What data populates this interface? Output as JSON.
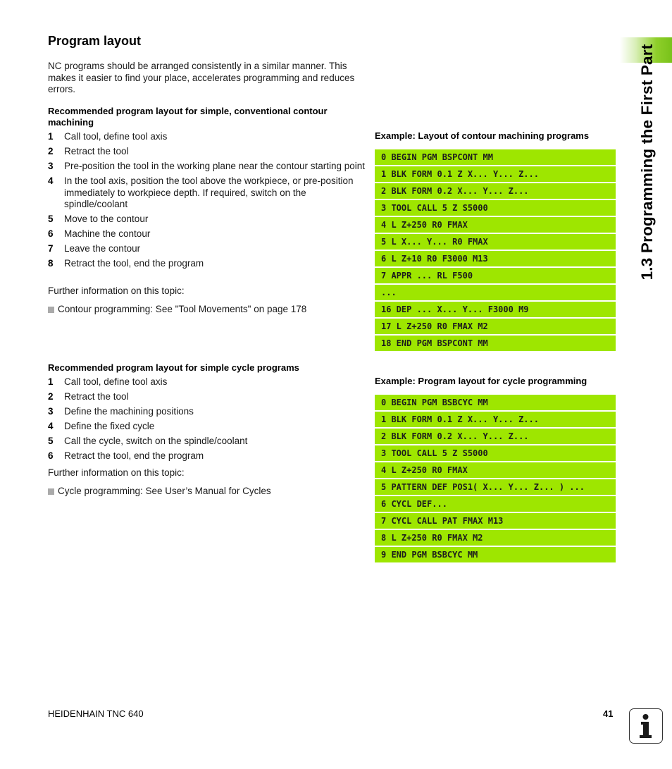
{
  "page": {
    "title": "Program layout",
    "intro": "NC programs should be arranged consistently in a similar manner. This makes it easier to find your place, accelerates programming and reduces errors.",
    "side_title": "1.3 Programming the First Part",
    "footer_left": "HEIDENHAIN TNC 640",
    "page_number": "41",
    "accent_color": "#9ee600"
  },
  "contour": {
    "heading": "Recommended program layout for simple, conventional contour machining",
    "steps": [
      {
        "num": "1",
        "text": "Call tool, define tool axis"
      },
      {
        "num": "2",
        "text": "Retract the tool"
      },
      {
        "num": "3",
        "text": "Pre-position the tool in the working plane near the contour starting point"
      },
      {
        "num": "4",
        "text": "In the tool axis, position the tool above the workpiece, or pre-position immediately to workpiece depth. If required, switch on the spindle/coolant"
      },
      {
        "num": "5",
        "text": "Move to the contour"
      },
      {
        "num": "6",
        "text": "Machine the contour"
      },
      {
        "num": "7",
        "text": "Leave the contour"
      },
      {
        "num": "8",
        "text": "Retract the tool, end the program"
      }
    ],
    "further_info": "Further information on this topic:",
    "link": "Contour programming: See \"Tool Movements\" on page 178",
    "example_title": "Example: Layout of contour machining programs",
    "example_lines": [
      "0 BEGIN PGM BSPCONT MM",
      "1 BLK FORM 0.1 Z X... Y... Z...",
      "2 BLK FORM 0.2 X... Y... Z...",
      "3 TOOL CALL 5 Z S5000",
      "4 L Z+250 R0 FMAX",
      "5 L X... Y... R0 FMAX",
      "6 L Z+10 R0 F3000 M13",
      "7 APPR ... RL F500",
      "...",
      "16 DEP ... X... Y... F3000 M9",
      "17 L Z+250 R0 FMAX M2",
      "18 END PGM BSPCONT MM"
    ]
  },
  "cycle": {
    "heading": "Recommended program layout for simple cycle programs",
    "steps": [
      {
        "num": "1",
        "text": "Call tool, define tool axis"
      },
      {
        "num": "2",
        "text": "Retract the tool"
      },
      {
        "num": "3",
        "text": "Define the machining positions"
      },
      {
        "num": "4",
        "text": "Define the fixed cycle"
      },
      {
        "num": "5",
        "text": "Call the cycle, switch on the spindle/coolant"
      },
      {
        "num": "6",
        "text": "Retract the tool, end the program"
      }
    ],
    "further_info": "Further information on this topic:",
    "link": "Cycle programming: See User’s Manual for Cycles",
    "example_title": "Example: Program layout for cycle programming",
    "example_lines": [
      "0 BEGIN PGM BSBCYC MM",
      "1 BLK FORM 0.1 Z X... Y... Z...",
      "2 BLK FORM 0.2 X... Y... Z...",
      "3 TOOL CALL 5 Z S5000",
      "4 L Z+250 R0 FMAX",
      "5 PATTERN DEF POS1( X... Y... Z... ) ...",
      "6 CYCL DEF...",
      "7 CYCL CALL PAT FMAX M13",
      "8 L Z+250 R0 FMAX M2",
      "9 END PGM BSBCYC MM"
    ]
  },
  "icons": {
    "info": "info-icon",
    "bullet": "square-bullet-icon"
  }
}
